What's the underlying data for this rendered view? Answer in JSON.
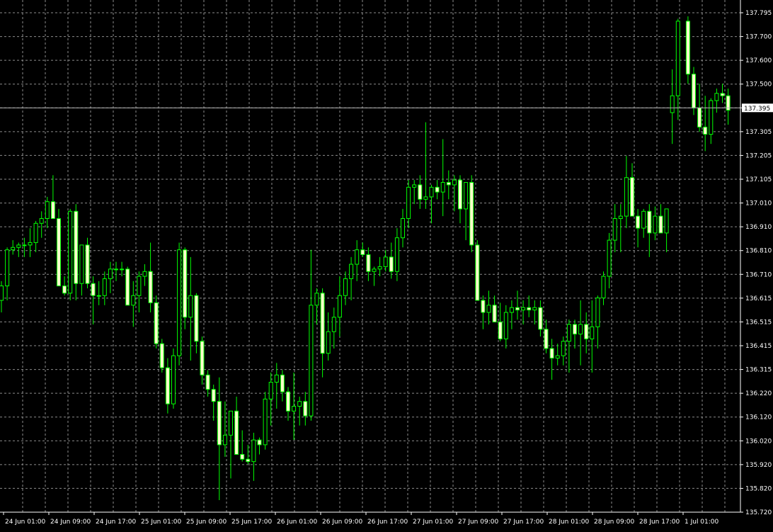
{
  "colors": {
    "background": "#000000",
    "grid": "#8c8c8c",
    "bull_body": "#000000",
    "bear_body": "#ffffff",
    "bull_wick": "#00ff00",
    "bear_outline": "#00ff00",
    "bear_body_fill": "#ffffcc",
    "axis_text": "#ffffff",
    "price_line": "#b4b4b4",
    "price_tag_bg": "#ffffff",
    "price_tag_text": "#000000"
  },
  "chart_data": {
    "type": "candlestick",
    "symbol_timeframe": "",
    "current_price": "137.395",
    "ylim": [
      135.72,
      137.795
    ],
    "y_ticks": [
      "137.795",
      "137.700",
      "137.600",
      "137.500",
      "137.395",
      "137.305",
      "137.205",
      "137.105",
      "137.010",
      "136.910",
      "136.810",
      "136.710",
      "136.615",
      "136.515",
      "136.415",
      "136.315",
      "136.220",
      "136.120",
      "136.020",
      "135.920",
      "135.820",
      "135.720"
    ],
    "x_ticks": [
      "24 Jun 01:00",
      "24 Jun 09:00",
      "24 Jun 17:00",
      "25 Jun 01:00",
      "25 Jun 09:00",
      "25 Jun 17:00",
      "26 Jun 01:00",
      "26 Jun 09:00",
      "26 Jun 17:00",
      "27 Jun 01:00",
      "27 Jun 09:00",
      "27 Jun 17:00",
      "28 Jun 01:00",
      "28 Jun 09:00",
      "28 Jun 17:00",
      "1 Jul 01:00"
    ],
    "grid": true,
    "candles": [
      [
        136.6,
        136.68,
        136.55,
        136.66
      ],
      [
        136.66,
        136.82,
        136.6,
        136.81
      ],
      [
        136.81,
        136.85,
        136.79,
        136.82
      ],
      [
        136.82,
        136.84,
        136.78,
        136.83
      ],
      [
        136.83,
        136.86,
        136.78,
        136.83
      ],
      [
        136.83,
        136.9,
        136.78,
        136.84
      ],
      [
        136.84,
        136.93,
        136.8,
        136.92
      ],
      [
        136.92,
        136.97,
        136.86,
        136.94
      ],
      [
        136.94,
        137.03,
        136.9,
        137.01
      ],
      [
        137.01,
        137.12,
        136.96,
        136.94
      ],
      [
        136.94,
        136.98,
        136.68,
        136.66
      ],
      [
        136.66,
        136.7,
        136.62,
        136.63
      ],
      [
        136.63,
        136.98,
        136.6,
        136.97
      ],
      [
        136.97,
        137.0,
        136.6,
        136.67
      ],
      [
        136.67,
        136.82,
        136.62,
        136.83
      ],
      [
        136.83,
        136.86,
        136.65,
        136.67
      ],
      [
        136.67,
        136.7,
        136.5,
        136.62
      ],
      [
        136.62,
        136.68,
        136.58,
        136.62
      ],
      [
        136.62,
        136.72,
        136.58,
        136.69
      ],
      [
        136.69,
        136.76,
        136.63,
        136.73
      ],
      [
        136.73,
        136.76,
        136.68,
        136.73
      ],
      [
        136.73,
        136.76,
        136.7,
        136.73
      ],
      [
        136.73,
        136.74,
        136.58,
        136.58
      ],
      [
        136.58,
        136.68,
        136.49,
        136.62
      ],
      [
        136.62,
        136.72,
        136.55,
        136.7
      ],
      [
        136.7,
        136.75,
        136.66,
        136.72
      ],
      [
        136.72,
        136.84,
        136.55,
        136.59
      ],
      [
        136.59,
        136.62,
        136.4,
        136.42
      ],
      [
        136.42,
        136.44,
        136.3,
        136.32
      ],
      [
        136.32,
        136.36,
        136.13,
        136.17
      ],
      [
        136.17,
        136.4,
        136.15,
        136.37
      ],
      [
        136.37,
        136.84,
        136.33,
        136.81
      ],
      [
        136.81,
        136.82,
        136.48,
        136.53
      ],
      [
        136.53,
        136.78,
        136.35,
        136.62
      ],
      [
        136.62,
        136.63,
        136.38,
        136.43
      ],
      [
        136.43,
        136.45,
        136.25,
        136.29
      ],
      [
        136.29,
        136.31,
        136.2,
        136.23
      ],
      [
        136.23,
        136.25,
        136.1,
        136.18
      ],
      [
        136.18,
        136.28,
        135.77,
        136.0
      ],
      [
        136.0,
        136.18,
        135.95,
        136.04
      ],
      [
        136.04,
        136.1,
        135.86,
        136.14
      ],
      [
        136.14,
        136.2,
        136.0,
        135.96
      ],
      [
        135.96,
        136.06,
        135.93,
        135.94
      ],
      [
        135.94,
        136.0,
        135.92,
        135.93
      ],
      [
        135.93,
        136.05,
        135.85,
        136.02
      ],
      [
        136.02,
        136.03,
        135.96,
        136.0
      ],
      [
        136.0,
        136.22,
        135.98,
        136.19
      ],
      [
        136.19,
        136.3,
        136.08,
        136.26
      ],
      [
        136.26,
        136.34,
        136.15,
        136.29
      ],
      [
        136.29,
        136.31,
        136.18,
        136.22
      ],
      [
        136.22,
        136.24,
        136.1,
        136.14
      ],
      [
        136.14,
        136.3,
        136.02,
        136.16
      ],
      [
        136.16,
        136.2,
        136.08,
        136.18
      ],
      [
        136.18,
        136.22,
        136.08,
        136.12
      ],
      [
        136.12,
        136.81,
        136.1,
        136.58
      ],
      [
        136.58,
        136.65,
        136.5,
        136.63
      ],
      [
        136.63,
        136.65,
        136.28,
        136.38
      ],
      [
        136.38,
        136.55,
        136.35,
        136.47
      ],
      [
        136.47,
        136.57,
        136.4,
        136.53
      ],
      [
        136.53,
        136.7,
        136.45,
        136.62
      ],
      [
        136.62,
        136.72,
        136.58,
        136.69
      ],
      [
        136.69,
        136.78,
        136.6,
        136.75
      ],
      [
        136.75,
        136.85,
        136.68,
        136.81
      ],
      [
        136.81,
        136.84,
        136.78,
        136.79
      ],
      [
        136.79,
        136.82,
        136.68,
        136.72
      ],
      [
        136.72,
        136.74,
        136.66,
        136.73
      ],
      [
        136.73,
        136.78,
        136.7,
        136.74
      ],
      [
        136.74,
        136.81,
        136.72,
        136.78
      ],
      [
        136.78,
        136.84,
        136.69,
        136.72
      ],
      [
        136.72,
        136.9,
        136.68,
        136.86
      ],
      [
        136.86,
        136.98,
        136.82,
        136.94
      ],
      [
        136.94,
        137.1,
        136.9,
        137.07
      ],
      [
        137.07,
        137.1,
        137.0,
        137.08
      ],
      [
        137.08,
        137.12,
        136.98,
        137.02
      ],
      [
        137.02,
        137.34,
        136.98,
        137.03
      ],
      [
        137.03,
        137.08,
        136.92,
        137.07
      ],
      [
        137.07,
        137.1,
        137.02,
        137.05
      ],
      [
        137.05,
        137.27,
        136.95,
        137.09
      ],
      [
        137.09,
        137.14,
        137.02,
        137.08
      ],
      [
        137.08,
        137.12,
        136.97,
        137.1
      ],
      [
        137.1,
        137.12,
        136.92,
        136.98
      ],
      [
        136.98,
        137.08,
        136.85,
        137.09
      ],
      [
        137.09,
        137.12,
        136.8,
        136.83
      ],
      [
        136.83,
        136.85,
        136.6,
        136.6
      ],
      [
        136.6,
        136.62,
        136.48,
        136.55
      ],
      [
        136.55,
        136.64,
        136.5,
        136.58
      ],
      [
        136.58,
        136.62,
        136.53,
        136.51
      ],
      [
        136.51,
        136.59,
        136.43,
        136.44
      ],
      [
        136.44,
        136.58,
        136.4,
        136.55
      ],
      [
        136.55,
        136.6,
        136.48,
        136.57
      ],
      [
        136.57,
        136.64,
        136.52,
        136.56
      ],
      [
        136.56,
        136.6,
        136.5,
        136.57
      ],
      [
        136.57,
        136.62,
        136.53,
        136.56
      ],
      [
        136.56,
        136.6,
        136.5,
        136.57
      ],
      [
        136.57,
        136.6,
        136.45,
        136.48
      ],
      [
        136.48,
        136.52,
        136.38,
        136.4
      ],
      [
        136.4,
        136.44,
        136.27,
        136.36
      ],
      [
        136.36,
        136.42,
        136.33,
        136.37
      ],
      [
        136.37,
        136.45,
        136.33,
        136.43
      ],
      [
        136.43,
        136.52,
        136.3,
        136.5
      ],
      [
        136.5,
        136.52,
        136.4,
        136.46
      ],
      [
        136.46,
        136.6,
        136.33,
        136.5
      ],
      [
        136.5,
        136.55,
        136.38,
        136.44
      ],
      [
        136.44,
        136.6,
        136.3,
        136.49
      ],
      [
        136.49,
        136.62,
        136.4,
        136.61
      ],
      [
        136.61,
        136.72,
        136.58,
        136.7
      ],
      [
        136.7,
        136.88,
        136.65,
        136.85
      ],
      [
        136.85,
        137.0,
        136.8,
        136.94
      ],
      [
        136.94,
        137.0,
        136.8,
        136.95
      ],
      [
        136.95,
        137.2,
        136.9,
        137.11
      ],
      [
        137.11,
        137.17,
        136.96,
        136.95
      ],
      [
        136.95,
        136.98,
        136.82,
        136.9
      ],
      [
        136.9,
        136.98,
        136.86,
        136.97
      ],
      [
        136.97,
        137.0,
        136.78,
        136.88
      ],
      [
        136.88,
        136.99,
        136.85,
        136.95
      ],
      [
        136.95,
        137.0,
        136.88,
        136.88
      ],
      [
        136.88,
        136.97,
        136.8,
        136.98
      ],
      [
        137.38,
        137.56,
        137.25,
        137.45
      ],
      [
        137.45,
        137.77,
        137.35,
        137.76
      ],
      [
        137.76,
        137.78,
        137.5,
        137.54
      ],
      [
        137.54,
        137.57,
        137.37,
        137.4
      ],
      [
        137.4,
        137.5,
        137.3,
        137.32
      ],
      [
        137.32,
        137.45,
        137.22,
        137.29
      ],
      [
        137.29,
        137.44,
        137.25,
        137.43
      ],
      [
        137.43,
        137.48,
        137.38,
        137.46
      ],
      [
        137.46,
        137.5,
        137.42,
        137.45
      ],
      [
        137.45,
        137.48,
        137.33,
        137.39
      ]
    ]
  }
}
